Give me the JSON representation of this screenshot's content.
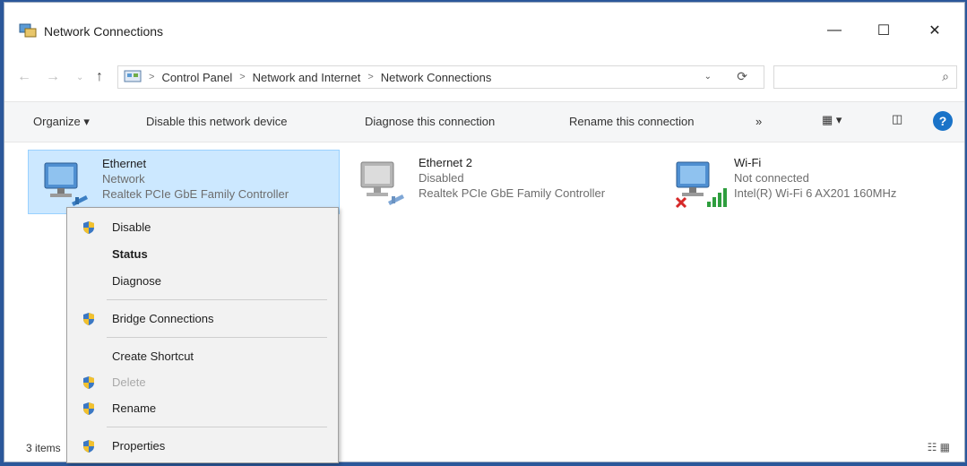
{
  "window": {
    "title": "Network Connections",
    "minimize": "—",
    "maximize": "☐",
    "close": "✕"
  },
  "address": {
    "back": "←",
    "forward": "→",
    "recent": "⌄",
    "up": "↑",
    "crumbs": [
      "Control Panel",
      "Network and Internet",
      "Network Connections"
    ],
    "separator": ">",
    "dropdown": "⌄",
    "refresh": "⟳",
    "search_placeholder": "",
    "search_icon": "⌕"
  },
  "toolbar": {
    "organize": "Organize ▾",
    "disable": "Disable this network device",
    "diagnose": "Diagnose this connection",
    "rename": "Rename this connection",
    "more": "»",
    "view": "▦ ▾",
    "pane": "◫",
    "help": "?"
  },
  "connections": [
    {
      "name": "Ethernet",
      "status": "Network",
      "device": "Realtek PCIe GbE Family Controller",
      "selected": true
    },
    {
      "name": "Ethernet 2",
      "status": "Disabled",
      "device": "Realtek PCIe GbE Family Controller",
      "selected": false
    },
    {
      "name": "Wi-Fi",
      "status": "Not connected",
      "device": "Intel(R) Wi-Fi 6 AX201 160MHz",
      "selected": false
    }
  ],
  "context_menu": {
    "items": [
      {
        "label": "Disable",
        "shield": true,
        "bold": false,
        "disabled": false
      },
      {
        "label": "Status",
        "shield": false,
        "bold": false,
        "disabled": false
      },
      {
        "label": "Diagnose",
        "shield": false,
        "bold": false,
        "disabled": false
      },
      {
        "label": "Bridge Connections",
        "shield": true,
        "bold": false,
        "disabled": false
      },
      {
        "label": "Create Shortcut",
        "shield": false,
        "bold": false,
        "disabled": false
      },
      {
        "label": "Delete",
        "shield": true,
        "bold": false,
        "disabled": true
      },
      {
        "label": "Rename",
        "shield": true,
        "bold": false,
        "disabled": false
      },
      {
        "label": "Properties",
        "shield": true,
        "bold": false,
        "disabled": false
      }
    ]
  },
  "statusbar": {
    "count": "3 items",
    "views": "☷ ▦"
  },
  "colors": {
    "selection": "#cce8ff",
    "selection_border": "#99d1ff",
    "menu_bg": "#f2f2f2",
    "help_blue": "#1a73c8",
    "desktop": "#2b579a"
  }
}
